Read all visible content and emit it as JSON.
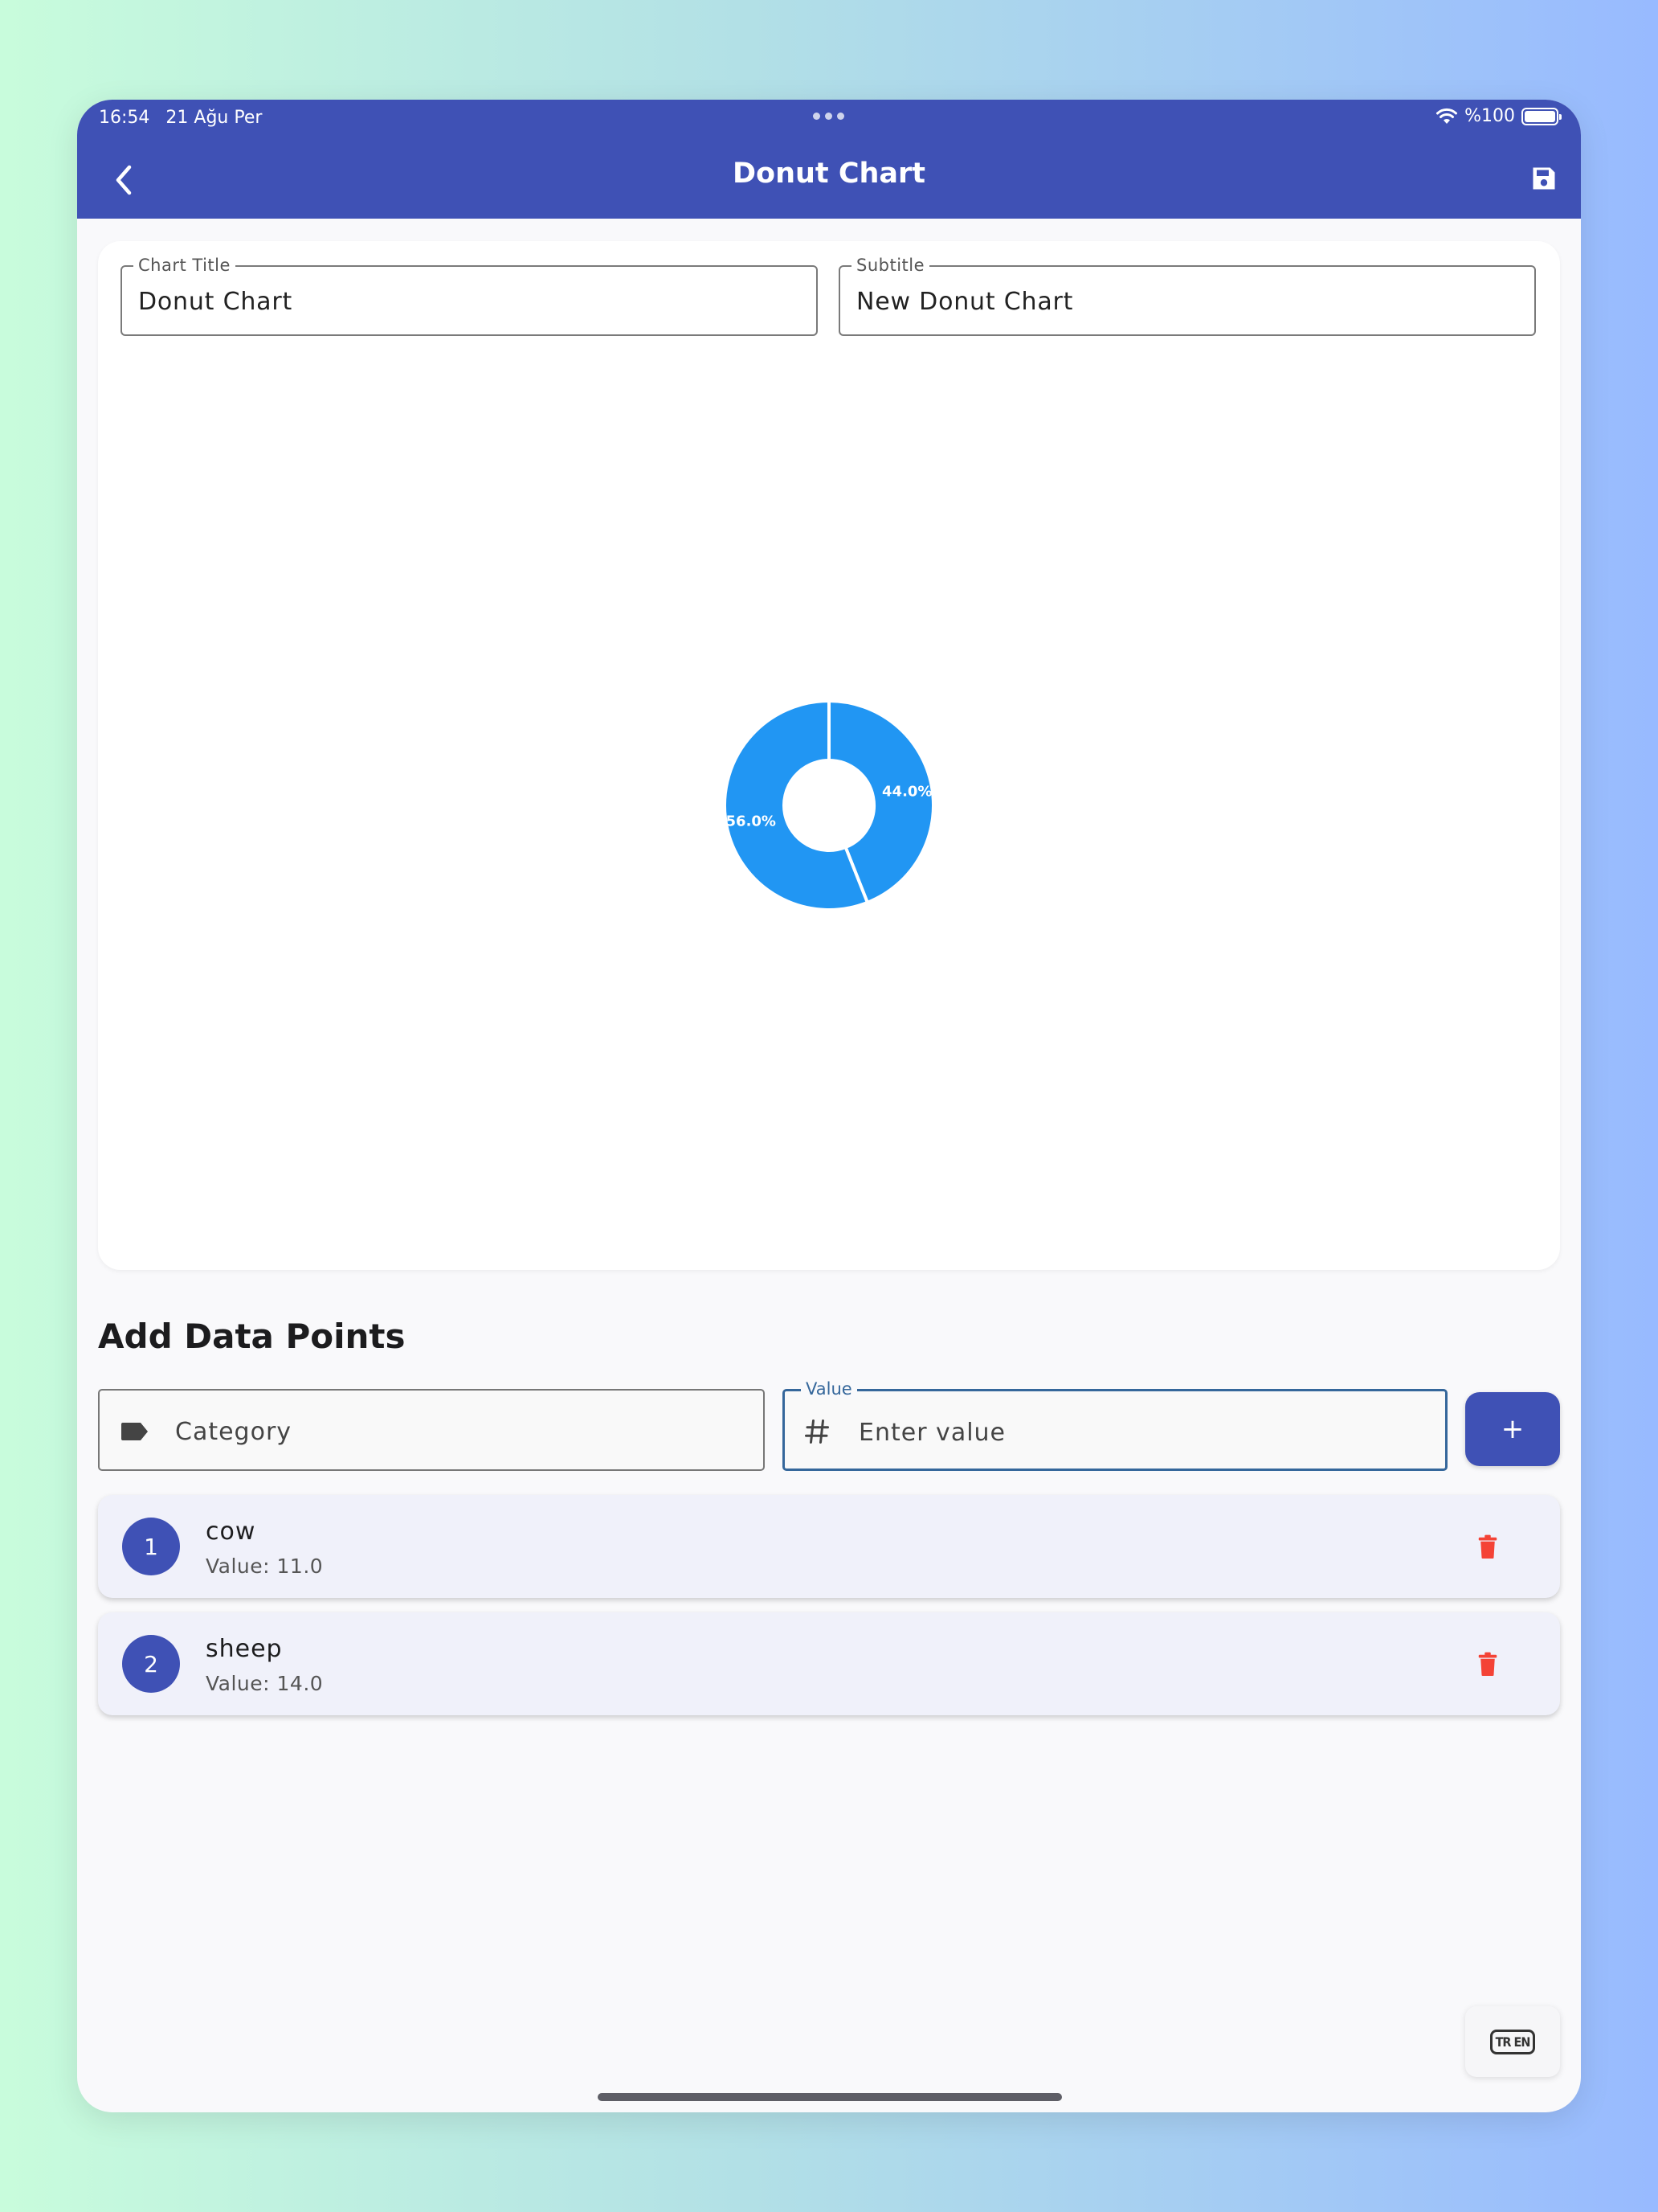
{
  "status_bar": {
    "time": "16:54",
    "date": "21 Ağu Per",
    "battery": "%100"
  },
  "app_bar": {
    "title": "Donut Chart"
  },
  "chart_form": {
    "title_label": "Chart Title",
    "title_value": "Donut Chart",
    "subtitle_label": "Subtitle",
    "subtitle_value": "New Donut Chart"
  },
  "chart_data": {
    "type": "pie",
    "donut": true,
    "categories": [
      "cow",
      "sheep"
    ],
    "values": [
      11.0,
      14.0
    ],
    "labels": [
      "44.0%",
      "56.0%"
    ],
    "colors": [
      "#2196f3",
      "#2196f3"
    ]
  },
  "add_section": {
    "title": "Add Data Points",
    "category_placeholder": "Category",
    "value_label": "Value",
    "value_placeholder": "Enter value",
    "add_label": "+"
  },
  "data_points": [
    {
      "index": "1",
      "name": "cow",
      "value_text": "Value: 11.0"
    },
    {
      "index": "2",
      "name": "sheep",
      "value_text": "Value: 14.0"
    }
  ],
  "lang_toggle": {
    "label": "TR EN"
  },
  "colors": {
    "primary": "#3f51b5",
    "chart_blue": "#2196f3",
    "delete_red": "#f44336"
  }
}
